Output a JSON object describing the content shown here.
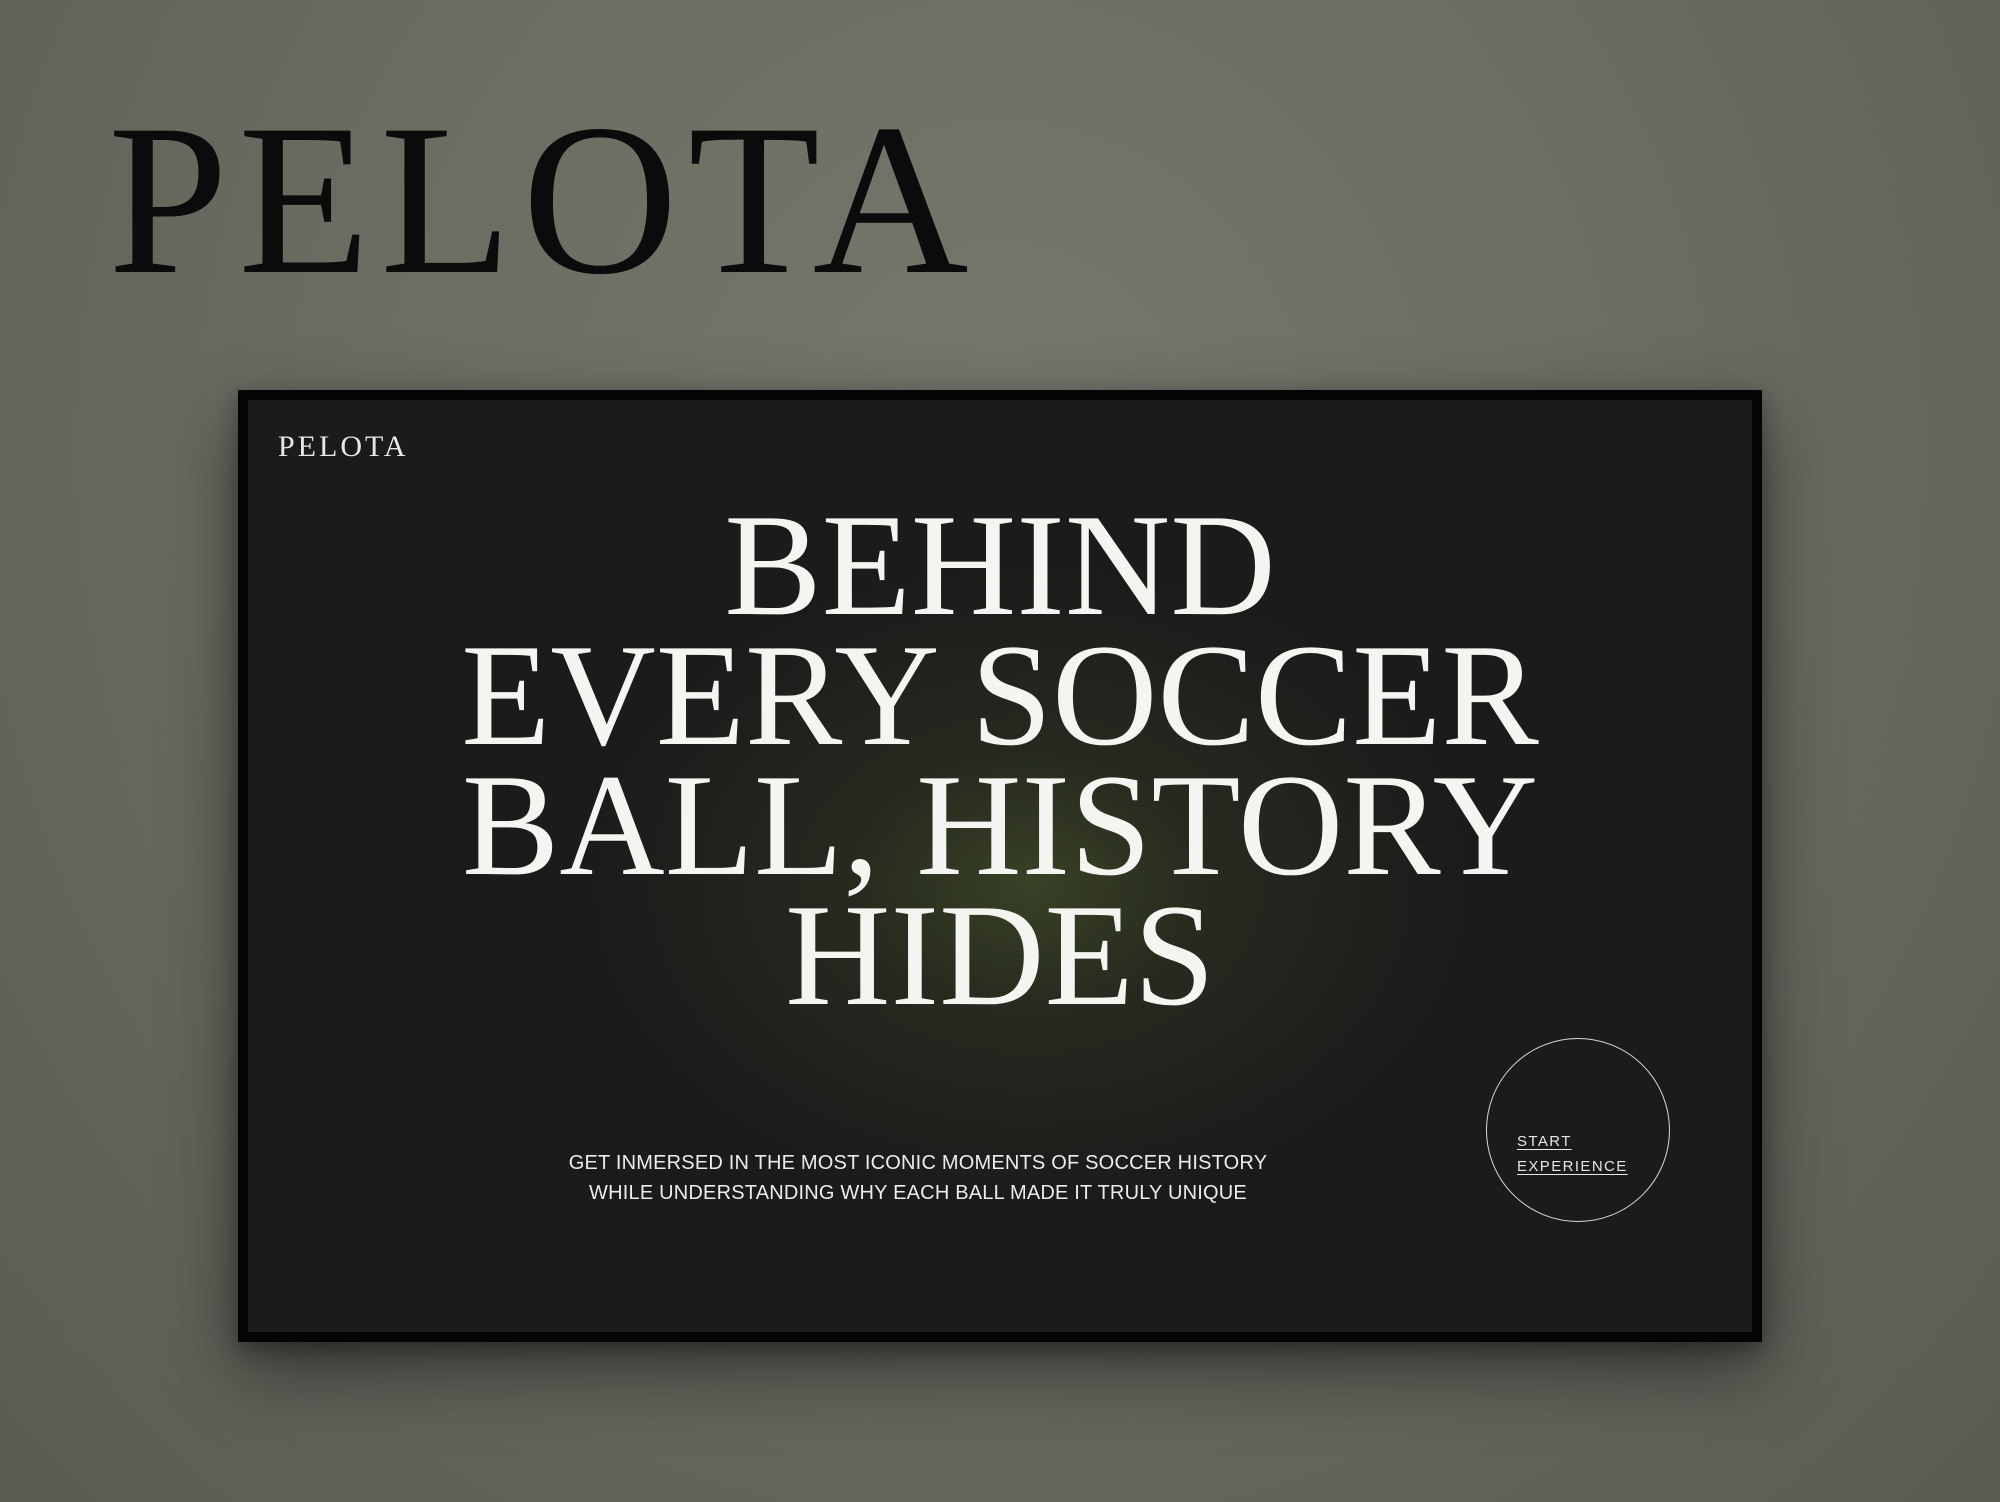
{
  "brand": {
    "name": "PELOTA"
  },
  "screen": {
    "logo": "PELOTA",
    "headline": {
      "lines": [
        "BEHIND",
        "EVERY SOCCER",
        "BALL, HISTORY",
        "HIDES"
      ]
    },
    "tagline": {
      "lines": [
        "GET INMERSED IN THE MOST ICONIC MOMENTS OF SOCCER HISTORY",
        "WHILE UNDERSTANDING WHY EACH BALL MADE IT TRULY UNIQUE"
      ]
    },
    "cta": {
      "line1": "START",
      "line2": "EXPERIENCE"
    }
  },
  "colors": {
    "background": "#6b6d63",
    "screen_bg": "#1b1b1b",
    "glow": "#3e4828",
    "text_light": "#f4f4f0",
    "brand_dark": "#0b0b0b"
  }
}
